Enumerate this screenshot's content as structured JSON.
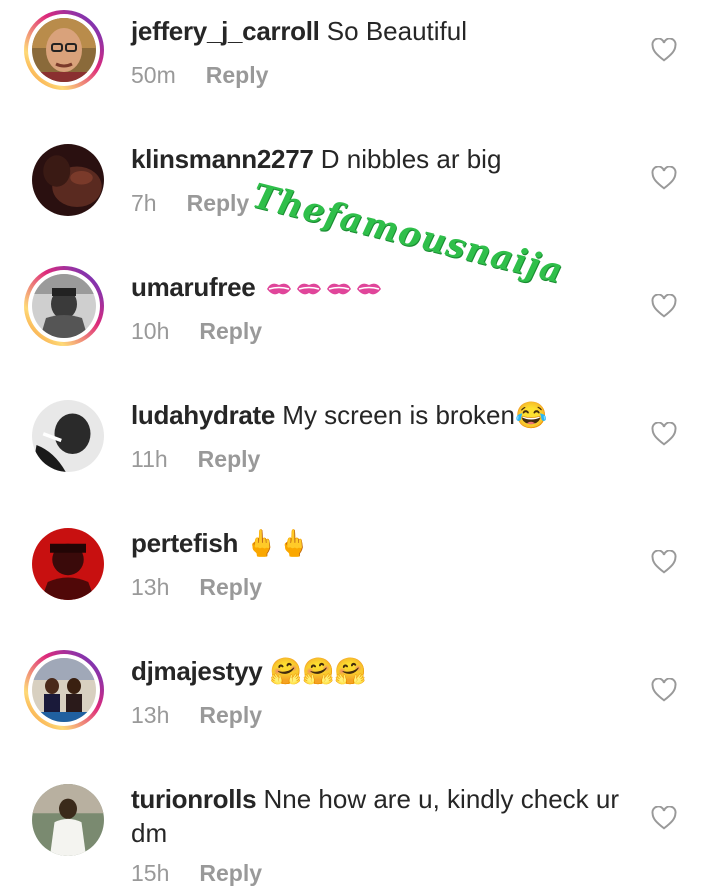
{
  "comments": [
    {
      "username": "jeffery_j_carroll",
      "text": " So Beautiful",
      "time": "50m",
      "reply": "Reply",
      "avatar": "face-portrait-yellow"
    },
    {
      "username": "klinsmann2277",
      "text": " D nibbles ar big",
      "time": "7h",
      "reply": "Reply",
      "avatar": "dark-portrait"
    },
    {
      "username": "umarufree",
      "text": " ",
      "time": "10h",
      "reply": "Reply",
      "avatar": "man-portrait-bw",
      "emoji": "kiss-mark-icon x4"
    },
    {
      "username": "ludahydrate",
      "text": " My screen is broken😂",
      "time": "11h",
      "reply": "Reply",
      "avatar": "man-portrait-bw-2"
    },
    {
      "username": "pertefish",
      "text": " 🖕🖕",
      "time": "13h",
      "reply": "Reply",
      "avatar": "red-portrait"
    },
    {
      "username": "djmajestyy",
      "text": " 🤗🤗🤗",
      "time": "13h",
      "reply": "Reply",
      "avatar": "group-photo"
    },
    {
      "username": "turionrolls",
      "text": " Nne how are u, kindly check ur dm",
      "time": "15h",
      "reply": "Reply",
      "avatar": "white-robe-portrait"
    }
  ],
  "watermark": "Thefamousnaija",
  "colors": {
    "ring_start": "#f58529",
    "ring_end": "#8134af",
    "meta": "#999999",
    "text": "#262626",
    "watermark": "#2fbf4a"
  }
}
